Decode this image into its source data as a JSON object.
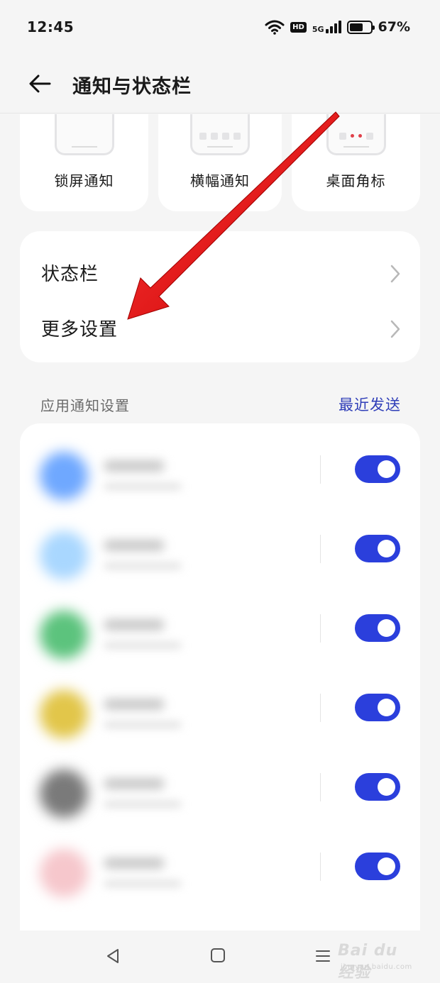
{
  "status_bar": {
    "time": "12:45",
    "network": "HD",
    "signal": "5G",
    "battery_level": 0.67,
    "battery_text": "67%"
  },
  "header": {
    "title": "通知与状态栏",
    "back_icon": "arrow-left-icon"
  },
  "notification_styles": [
    {
      "label": "锁屏通知"
    },
    {
      "label": "横幅通知"
    },
    {
      "label": "桌面角标"
    }
  ],
  "settings": [
    {
      "label": "状态栏"
    },
    {
      "label": "更多设置"
    }
  ],
  "app_notifications": {
    "section_title": "应用通知设置",
    "sort_link": "最近发送",
    "apps": [
      {
        "icon_color": "#6fa8ff",
        "enabled": true
      },
      {
        "icon_color": "#a9d7ff",
        "enabled": true
      },
      {
        "icon_color": "#5cc37d",
        "enabled": true
      },
      {
        "icon_color": "#e2c64a",
        "enabled": true
      },
      {
        "icon_color": "#7a7a7a",
        "enabled": true
      },
      {
        "icon_color": "#f6c7cc",
        "enabled": true
      }
    ]
  },
  "colors": {
    "accent": "#2b3fdc",
    "link": "#2f3eb8",
    "annotation": "#e01010"
  },
  "nav_bar": {
    "back_icon": "triangle-back-icon",
    "home_icon": "square-home-icon",
    "menu_icon": "menu-lines-icon"
  },
  "watermark": {
    "brand": "Bai du 经验",
    "url": "jingyan.baidu.com"
  }
}
